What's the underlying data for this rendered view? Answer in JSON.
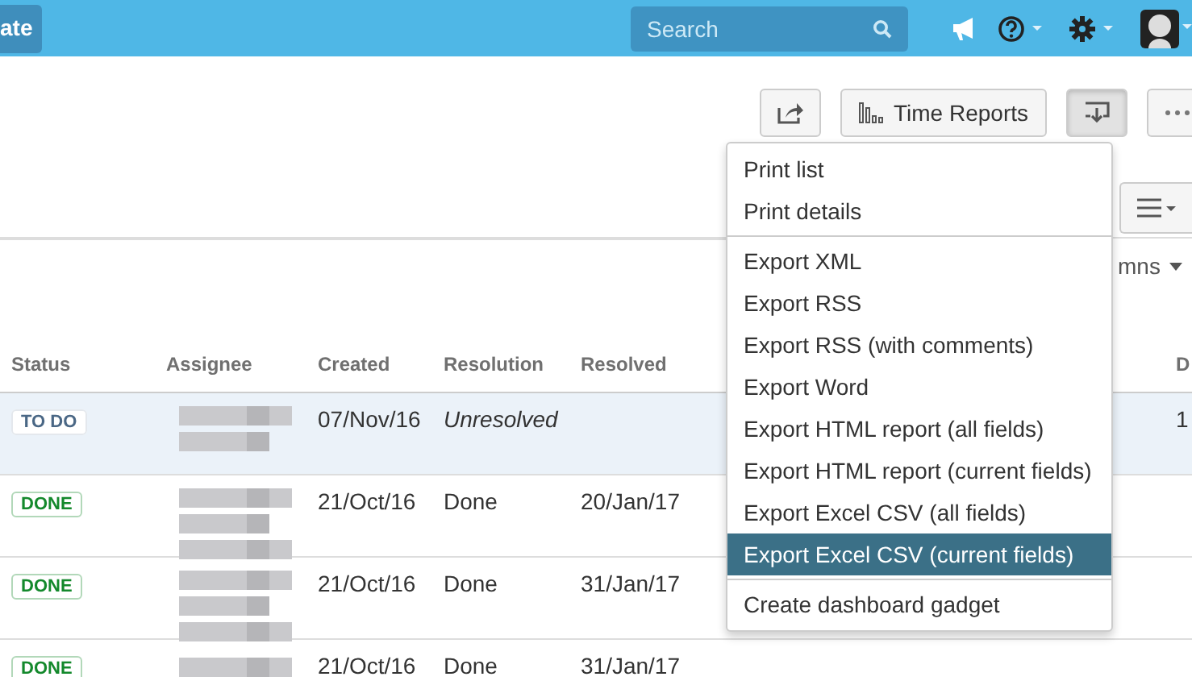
{
  "top_bar": {
    "create_button": "ate",
    "search": {
      "placeholder": "Search"
    }
  },
  "toolbar": {
    "time_reports_button": "Time Reports",
    "export_open": true
  },
  "columns_button": "mns",
  "table": {
    "columns": [
      "Status",
      "Assignee",
      "Created",
      "Resolution",
      "Resolved",
      "D"
    ],
    "rows": [
      {
        "status": "TO DO",
        "kind": "todo",
        "created": "07/Nov/16",
        "resolution": "Unresolved",
        "due": "1",
        "selected": true
      },
      {
        "status": "DONE",
        "kind": "done",
        "created": "21/Oct/16",
        "resolution": "Done",
        "resolved": "20/Jan/17",
        "selected": false
      },
      {
        "status": "DONE",
        "kind": "done",
        "created": "21/Oct/16",
        "resolution": "Done",
        "resolved": "31/Jan/17",
        "selected": false
      },
      {
        "status": "DONE",
        "kind": "done",
        "created": "21/Oct/16",
        "resolution": "Done",
        "resolved": "31/Jan/17",
        "selected": false
      }
    ]
  },
  "export_menu": {
    "groups": [
      [
        {
          "label": "Print list",
          "selected": false
        },
        {
          "label": "Print details",
          "selected": false
        }
      ],
      [
        {
          "label": "Export XML",
          "selected": false
        },
        {
          "label": "Export RSS",
          "selected": false
        },
        {
          "label": "Export RSS (with comments)",
          "selected": false
        },
        {
          "label": "Export Word",
          "selected": false
        },
        {
          "label": "Export HTML report (all fields)",
          "selected": false
        },
        {
          "label": "Export HTML report (current fields)",
          "selected": false
        },
        {
          "label": "Export Excel CSV (all fields)",
          "selected": false
        },
        {
          "label": "Export Excel CSV (current fields)",
          "selected": true
        }
      ],
      [
        {
          "label": "Create dashboard gadget",
          "selected": false
        }
      ]
    ]
  }
}
